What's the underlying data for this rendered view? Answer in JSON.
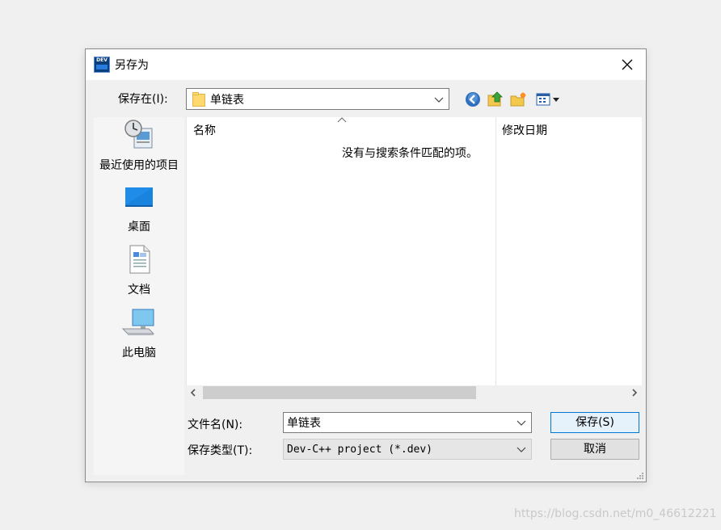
{
  "window": {
    "title": "另存为"
  },
  "app_icon": {
    "text": "DEV",
    "name": "dev-cpp-icon"
  },
  "location": {
    "label": "保存在(I):",
    "current_folder": "单链表"
  },
  "toolbar": {
    "icons": [
      "back-icon",
      "up-folder-icon",
      "new-folder-icon",
      "view-menu-icon"
    ]
  },
  "places": [
    {
      "label": "最近使用的项目",
      "icon": "recent-items-icon"
    },
    {
      "label": "桌面",
      "icon": "desktop-icon"
    },
    {
      "label": "文档",
      "icon": "documents-icon"
    },
    {
      "label": "此电脑",
      "icon": "this-pc-icon"
    }
  ],
  "file_list": {
    "columns": [
      "名称",
      "修改日期"
    ],
    "sorted_column": "名称",
    "empty_message": "没有与搜索条件匹配的项。"
  },
  "filename": {
    "label": "文件名(N):",
    "value": "单链表"
  },
  "filetype": {
    "label": "保存类型(T):",
    "value": "Dev-C++ project (*.dev)"
  },
  "buttons": {
    "save": "保存(S)",
    "cancel": "取消"
  },
  "watermark": "https://blog.csdn.net/m0_46612221"
}
